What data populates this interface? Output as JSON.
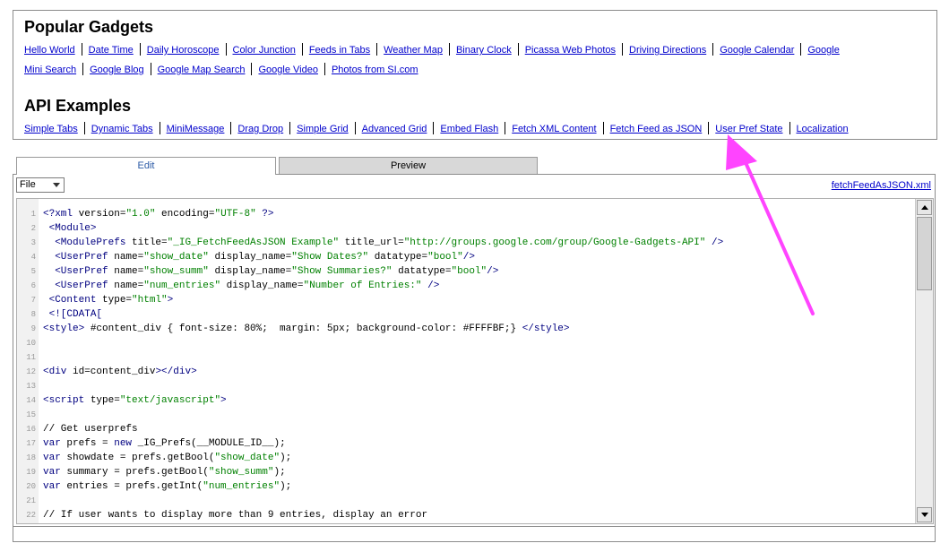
{
  "popular": {
    "title": "Popular Gadgets",
    "row1": [
      "Hello World",
      "Date Time",
      "Daily Horoscope",
      "Color Junction",
      "Feeds in Tabs",
      "Weather Map",
      "Binary Clock",
      "Picassa Web Photos",
      "Driving Directions",
      "Google Calendar",
      "Google"
    ],
    "row2": [
      "Mini Search",
      "Google Blog",
      "Google Map Search",
      "Google Video",
      "Photos from SI.com"
    ]
  },
  "api": {
    "title": "API Examples",
    "links": [
      "Simple Tabs",
      "Dynamic Tabs",
      "MiniMessage",
      "Drag Drop",
      "Simple Grid",
      "Advanced Grid",
      "Embed Flash",
      "Fetch XML Content",
      "Fetch Feed as JSON",
      "User Pref State",
      "Localization"
    ]
  },
  "tabs": {
    "edit": "Edit",
    "preview": "Preview"
  },
  "toolbar": {
    "file_menu": "File",
    "filename": "fetchFeedAsJSON.xml"
  },
  "code": [
    {
      "n": "1",
      "t": "<?xml version=\"1.0\" encoding=\"UTF-8\" ?>"
    },
    {
      "n": "2",
      "t": " <Module>"
    },
    {
      "n": "3",
      "t": "  <ModulePrefs title=\"_IG_FetchFeedAsJSON Example\" title_url=\"http://groups.google.com/group/Google-Gadgets-API\" />"
    },
    {
      "n": "4",
      "t": "  <UserPref name=\"show_date\" display_name=\"Show Dates?\" datatype=\"bool\"/>"
    },
    {
      "n": "5",
      "t": "  <UserPref name=\"show_summ\" display_name=\"Show Summaries?\" datatype=\"bool\"/>"
    },
    {
      "n": "6",
      "t": "  <UserPref name=\"num_entries\" display_name=\"Number of Entries:\" />"
    },
    {
      "n": "7",
      "t": " <Content type=\"html\">"
    },
    {
      "n": "8",
      "t": " <![CDATA["
    },
    {
      "n": "9",
      "t": "<style> #content_div { font-size: 80%;  margin: 5px; background-color: #FFFFBF;} </style>"
    },
    {
      "n": "10",
      "t": ""
    },
    {
      "n": "11",
      "t": ""
    },
    {
      "n": "12",
      "t": "<div id=content_div></div>"
    },
    {
      "n": "13",
      "t": ""
    },
    {
      "n": "14",
      "t": "<script type=\"text/javascript\">"
    },
    {
      "n": "15",
      "t": ""
    },
    {
      "n": "16",
      "t": "// Get userprefs"
    },
    {
      "n": "17",
      "t": "var prefs = new _IG_Prefs(__MODULE_ID__);"
    },
    {
      "n": "18",
      "t": "var showdate = prefs.getBool(\"show_date\");"
    },
    {
      "n": "19",
      "t": "var summary = prefs.getBool(\"show_summ\");"
    },
    {
      "n": "20",
      "t": "var entries = prefs.getInt(\"num_entries\");"
    },
    {
      "n": "21",
      "t": ""
    },
    {
      "n": "22",
      "t": "// If user wants to display more than 9 entries, display an error"
    }
  ],
  "colors": {
    "link": "#0000cc",
    "annotation": "#ff44ff",
    "tab_active_text": "#2b5aa6"
  }
}
